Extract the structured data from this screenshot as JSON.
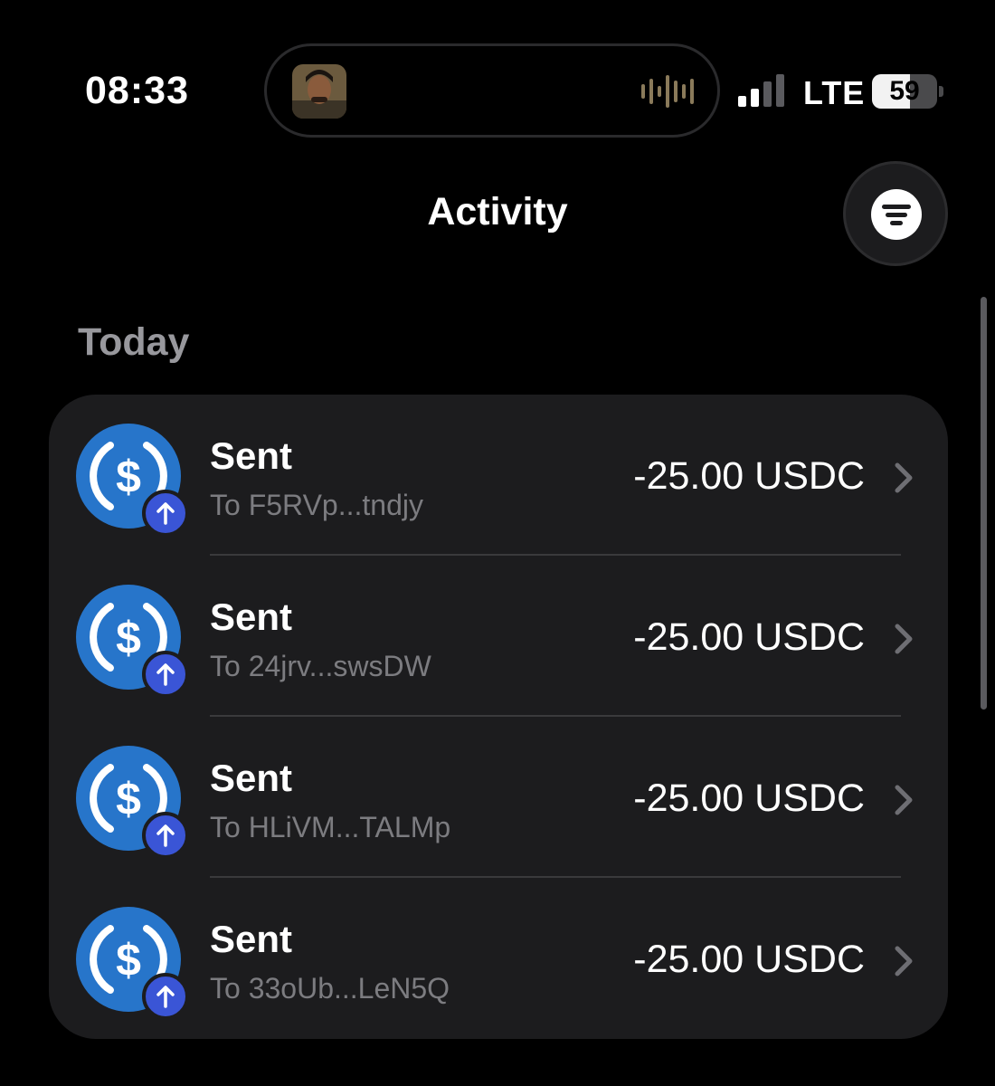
{
  "status_bar": {
    "time": "08:33",
    "network": "LTE",
    "battery": "59",
    "battery_level": 0.59
  },
  "header": {
    "title": "Activity",
    "filter_icon": "filter-icon"
  },
  "section": {
    "label": "Today"
  },
  "colors": {
    "background": "#000000",
    "card": "#1c1c1e",
    "usdc_blue": "#2775ca",
    "badge_blue": "#3a55d6",
    "muted_text": "#7c7c80"
  },
  "transactions": [
    {
      "title": "Sent",
      "subtitle": "To F5RVp...tndjy",
      "amount": "-25.00 USDC",
      "icon": "usdc-icon",
      "badge_icon": "arrow-up-icon"
    },
    {
      "title": "Sent",
      "subtitle": "To 24jrv...swsDW",
      "amount": "-25.00 USDC",
      "icon": "usdc-icon",
      "badge_icon": "arrow-up-icon"
    },
    {
      "title": "Sent",
      "subtitle": "To HLiVM...TALMp",
      "amount": "-25.00 USDC",
      "icon": "usdc-icon",
      "badge_icon": "arrow-up-icon"
    },
    {
      "title": "Sent",
      "subtitle": "To 33oUb...LeN5Q",
      "amount": "-25.00 USDC",
      "icon": "usdc-icon",
      "badge_icon": "arrow-up-icon"
    }
  ]
}
